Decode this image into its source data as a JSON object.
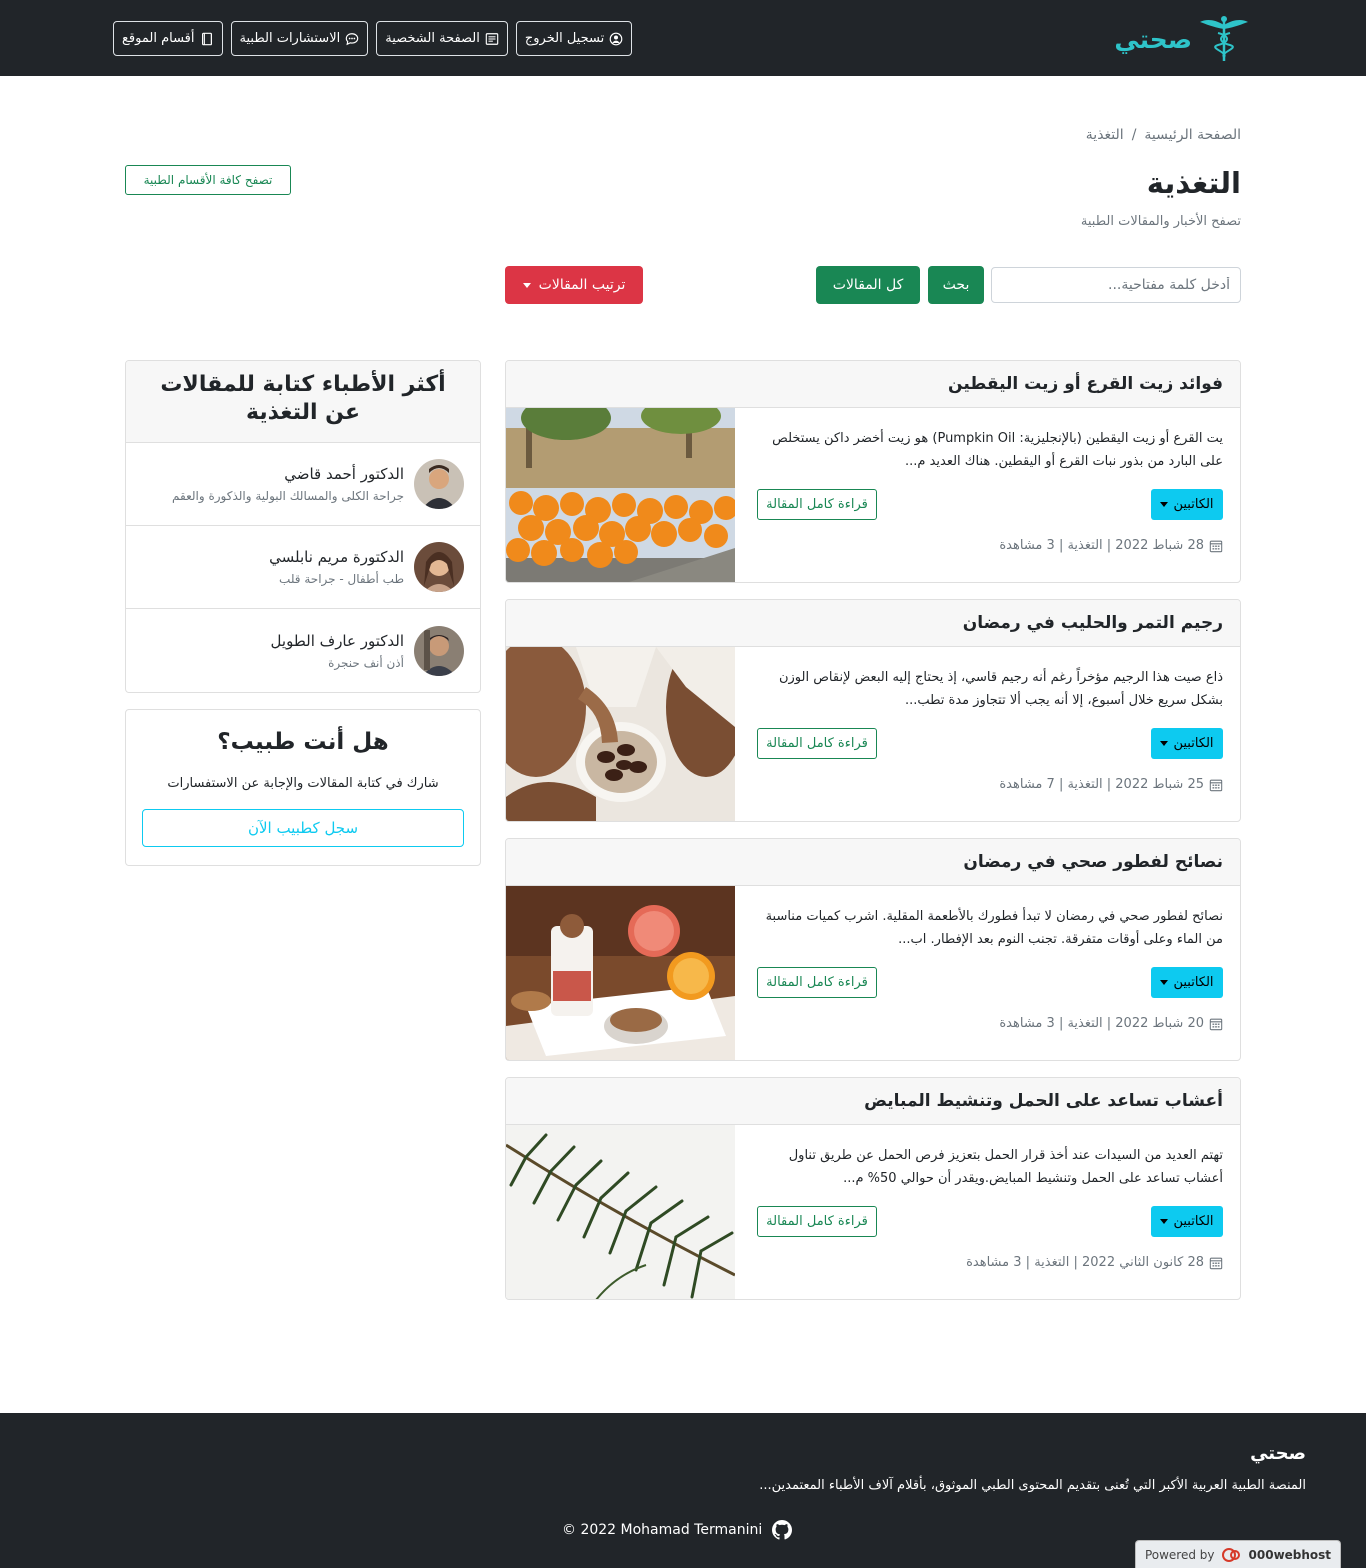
{
  "navbar": {
    "brand": "صحتي",
    "buttons": [
      "أقسام الموقع",
      "الاستشارات الطبية",
      "الصفحة الشخصية",
      "تسجيل الخروج"
    ]
  },
  "breadcrumb": {
    "home": "الصفحة الرئيسية",
    "separator": "/",
    "current": "التغذية"
  },
  "header": {
    "title": "التغذية",
    "subtitle": "تصفح الأخبار والمقالات الطبية",
    "browse_all": "تصفح كافة الأقسام الطبية"
  },
  "search": {
    "placeholder": "أدخل كلمة مفتاحية...",
    "search_label": "بحث",
    "all_label": "كل المقالات",
    "sort_label": "ترتيب المقالات"
  },
  "articles": [
    {
      "title": "فوائد زيت القرع أو زيت اليقطين",
      "excerpt": "يت القرع أو زيت اليقطين (بالإنجليزية: Pumpkin Oil) هو زيت أخضر داكن يستخلص على البارد من بذور نبات القرع أو اليقطين. هناك العديد م...",
      "writers_label": "الكاتبين",
      "read_label": "قراءة كامل المقالة",
      "meta": "28 شباط 2022 | التغذية | 3 مشاهدة"
    },
    {
      "title": "رجيم التمر والحليب في رمضان",
      "excerpt": "ذاع صيت هذا الرجيم مؤخراً رغم أنه رجيم قاسي، إذ يحتاج إليه البعض لإنقاص الوزن بشكل سريع خلال أسبوع، إلا أنه يجب ألا تتجاوز مدة تطب...",
      "writers_label": "الكاتبين",
      "read_label": "قراءة كامل المقالة",
      "meta": "25 شباط 2022 | التغذية | 7 مشاهدة"
    },
    {
      "title": "نصائح لفطور صحي في رمضان",
      "excerpt": "نصائح لفطور صحي في رمضان لا تبدأ فطورك بالأطعمة المقلية. اشرب كميات مناسبة من الماء وعلى أوقات متفرقة. تجنب النوم بعد الإفطار. اب...",
      "writers_label": "الكاتبين",
      "read_label": "قراءة كامل المقالة",
      "meta": "20 شباط 2022 | التغذية | 3 مشاهدة"
    },
    {
      "title": "أعشاب تساعد على الحمل وتنشيط المبايض",
      "excerpt": "تهتم العديد من السيدات عند أخذ قرار الحمل بتعزيز فرص الحمل عن طريق تناول أعشاب تساعد على الحمل وتنشيط المبايض.ويقدر أن حوالي 50% م...",
      "writers_label": "الكاتبين",
      "read_label": "قراءة كامل المقالة",
      "meta": "28 كانون الثاني 2022 | التغذية | 3 مشاهدة"
    }
  ],
  "top_doctors": {
    "title": "أكثر الأطباء كتابة للمقالات عن التغذية",
    "doctors": [
      {
        "name": "الدكتور أحمد قاضي",
        "specialty": "جراحة الكلى والمسالك البولية والذكورة والعقم"
      },
      {
        "name": "الدكتورة مريم نابلسي",
        "specialty": "طب أطفال - جراحة قلب"
      },
      {
        "name": "الدكتور عارف الطويل",
        "specialty": "أذن أنف حنجرة"
      }
    ]
  },
  "doctor_cta": {
    "title": "هل أنت طبيب؟",
    "text": "شارك في كتابة المقالات والإجابة عن الاستفسارات",
    "button": "سجل كطبيب الآن"
  },
  "footer": {
    "brand": "صحتي",
    "description": "المنصة الطبية العربية الأكبر التي تُعنى بتقديم المحتوى الطبي الموثوق، بأقلام آلاف الأطباء المعتمدين...",
    "copyright": "© 2022 Mohamad Termanini"
  },
  "powered": {
    "label": "Powered by",
    "host": "000webhost"
  }
}
